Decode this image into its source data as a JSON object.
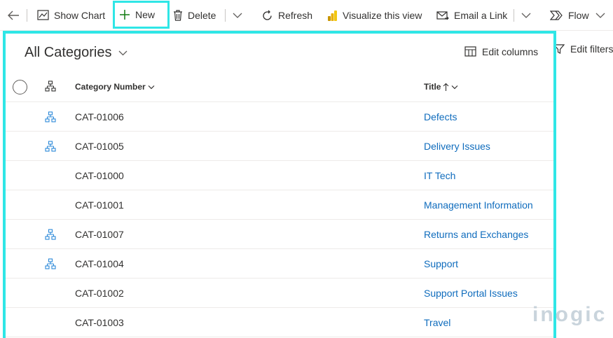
{
  "toolbar": {
    "show_chart": "Show Chart",
    "new": "New",
    "delete": "Delete",
    "refresh": "Refresh",
    "visualize": "Visualize this view",
    "email_link": "Email a Link",
    "flow": "Flow"
  },
  "view": {
    "title": "All Categories",
    "edit_columns": "Edit columns",
    "edit_filters": "Edit filters"
  },
  "grid": {
    "columns": {
      "category_number": "Category Number",
      "title": "Title"
    },
    "rows": [
      {
        "number": "CAT-01006",
        "title": "Defects",
        "hierarchy": true
      },
      {
        "number": "CAT-01005",
        "title": "Delivery Issues",
        "hierarchy": true
      },
      {
        "number": "CAT-01000",
        "title": "IT Tech",
        "hierarchy": false
      },
      {
        "number": "CAT-01001",
        "title": "Management Information",
        "hierarchy": false
      },
      {
        "number": "CAT-01007",
        "title": "Returns and Exchanges",
        "hierarchy": true
      },
      {
        "number": "CAT-01004",
        "title": "Support",
        "hierarchy": true
      },
      {
        "number": "CAT-01002",
        "title": "Support Portal Issues",
        "hierarchy": false
      },
      {
        "number": "CAT-01003",
        "title": "Travel",
        "hierarchy": false
      }
    ]
  },
  "watermark": "inogic",
  "colors": {
    "highlight": "#2fe6e6",
    "link": "#0f6cbd",
    "text": "#323130",
    "hierarchy_icon": "#2b88d8"
  }
}
